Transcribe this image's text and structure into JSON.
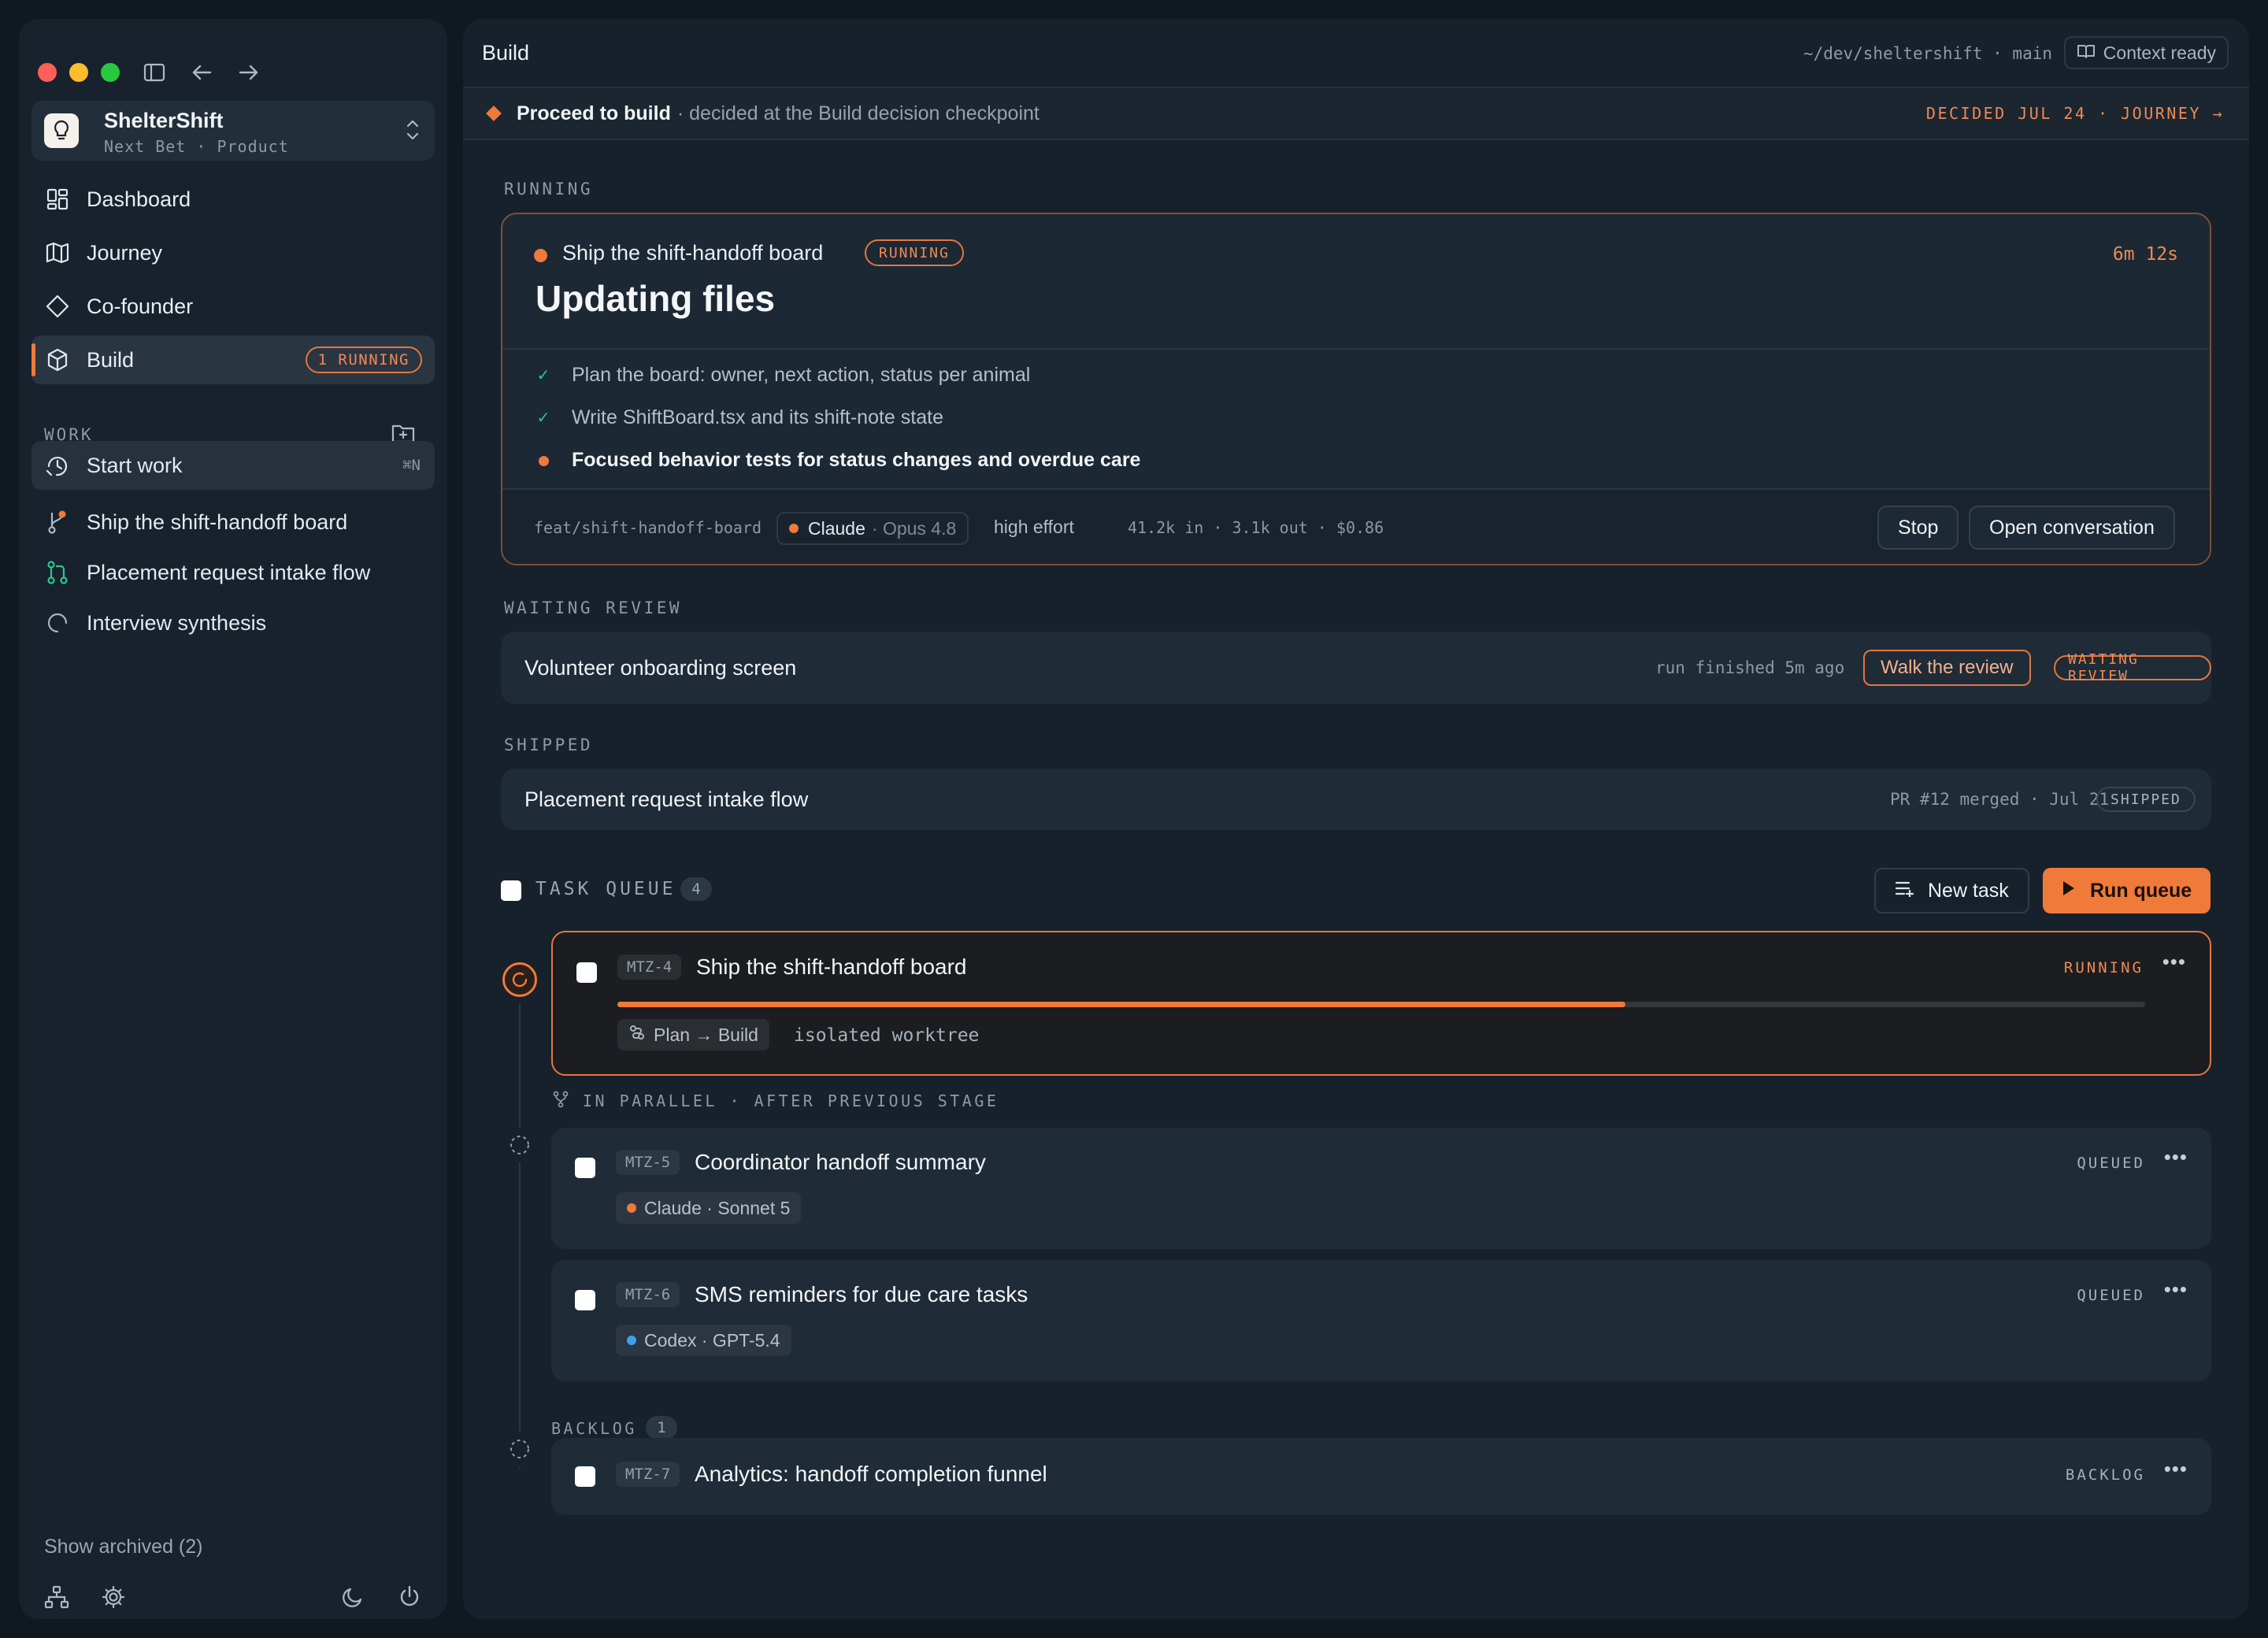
{
  "sidebar": {
    "workspace": {
      "name": "ShelterShift",
      "subtitle": "Next Bet · Product"
    },
    "nav": [
      {
        "label": "Dashboard",
        "icon": "dashboard-icon"
      },
      {
        "label": "Journey",
        "icon": "map-icon"
      },
      {
        "label": "Co-founder",
        "icon": "diamond-icon"
      },
      {
        "label": "Build",
        "icon": "cube-icon",
        "badge": "1 RUNNING",
        "active": true
      }
    ],
    "work_label": "WORK",
    "start_work": {
      "label": "Start work",
      "shortcut": "⌘N"
    },
    "work_items": [
      {
        "label": "Ship the shift-handoff board",
        "icon": "branch-icon"
      },
      {
        "label": "Placement request intake flow",
        "icon": "pull-request-icon"
      },
      {
        "label": "Interview synthesis",
        "icon": "loading-icon"
      }
    ],
    "show_archived": "Show archived (2)"
  },
  "header": {
    "title": "Build",
    "path": "~/dev/sheltershift · main",
    "context": "Context ready"
  },
  "decision": {
    "strong": "Proceed to build",
    "rest": "· decided at the Build decision checkpoint",
    "right": "DECIDED JUL 24 · JOURNEY →"
  },
  "running": {
    "section": "RUNNING",
    "name": "Ship the shift-handoff board",
    "badge": "RUNNING",
    "elapsed": "6m 12s",
    "title": "Updating files",
    "steps": [
      {
        "text": "Plan the board: owner, next action, status per animal",
        "state": "done",
        "mark": "✓"
      },
      {
        "text": "Write ShiftBoard.tsx and its shift-note state",
        "state": "done",
        "mark": "✓"
      },
      {
        "text": "Focused behavior tests for status changes and overdue care",
        "state": "current",
        "mark": ""
      }
    ],
    "branch": "feat/shift-handoff-board",
    "model": "Claude",
    "model_version": "· Opus 4.8",
    "effort": "high effort",
    "tokens": "41.2k in · 3.1k out · $0.86",
    "stop_label": "Stop",
    "open_label": "Open conversation"
  },
  "waiting": {
    "section": "WAITING REVIEW",
    "title": "Volunteer onboarding screen",
    "meta": "run finished 5m ago",
    "walk_label": "Walk the review",
    "badge": "WAITING REVIEW"
  },
  "shipped": {
    "section": "SHIPPED",
    "title": "Placement request intake flow",
    "meta": "PR #12 merged · Jul 21",
    "badge": "SHIPPED"
  },
  "queue": {
    "label": "TASK QUEUE",
    "count": "4",
    "new_task": "New task",
    "run_queue": "Run queue",
    "parallel_label": "IN PARALLEL · AFTER PREVIOUS STAGE",
    "backlog_label": "BACKLOG",
    "backlog_count": "1",
    "tasks": [
      {
        "id": "MTZ-4",
        "title": "Ship the shift-handoff board",
        "status": "RUNNING",
        "progress": 0.66,
        "tag": "Plan → Build",
        "extra": "isolated worktree"
      },
      {
        "id": "MTZ-5",
        "title": "Coordinator handoff summary",
        "status": "QUEUED",
        "tag": "Claude · Sonnet 5",
        "tag_color": "#f07a3a"
      },
      {
        "id": "MTZ-6",
        "title": "SMS reminders for due care tasks",
        "status": "QUEUED",
        "tag": "Codex · GPT-5.4",
        "tag_color": "#3aa0f0"
      },
      {
        "id": "MTZ-7",
        "title": "Analytics: handoff completion funnel",
        "status": "BACKLOG"
      }
    ]
  },
  "colors": {
    "accent": "#f07a3a",
    "success": "#31c48d",
    "codex": "#3aa0f0"
  }
}
